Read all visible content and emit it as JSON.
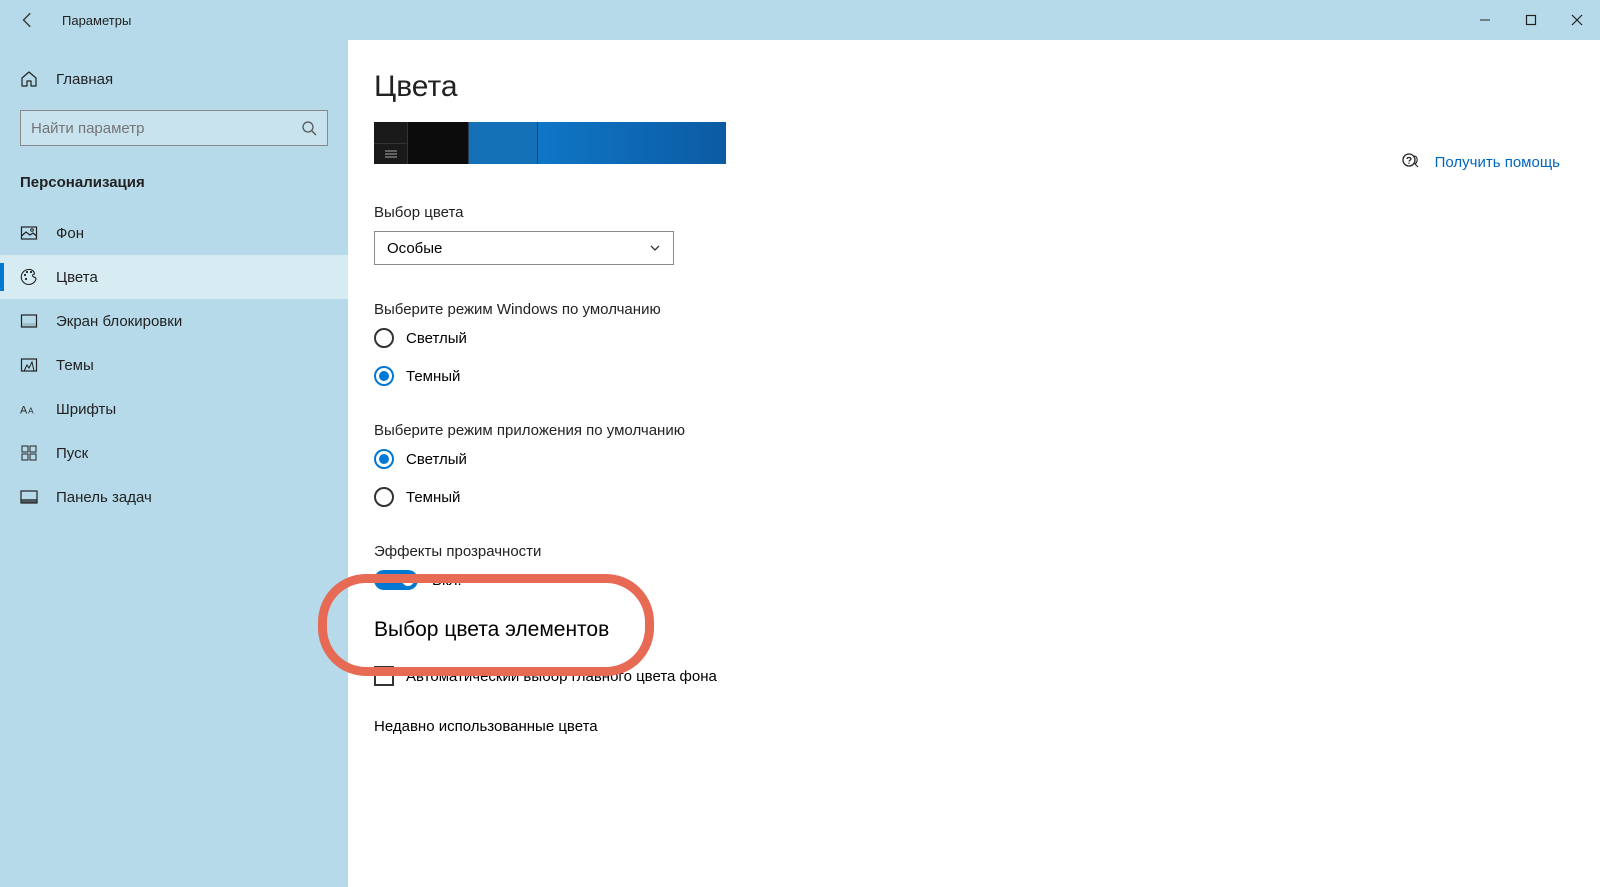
{
  "titlebar": {
    "app_name": "Параметры"
  },
  "sidebar": {
    "home_label": "Главная",
    "search_placeholder": "Найти параметр",
    "section_label": "Персонализация",
    "items": [
      {
        "label": "Фон",
        "icon": "picture-icon"
      },
      {
        "label": "Цвета",
        "icon": "palette-icon"
      },
      {
        "label": "Экран блокировки",
        "icon": "lockscreen-icon"
      },
      {
        "label": "Темы",
        "icon": "themes-icon"
      },
      {
        "label": "Шрифты",
        "icon": "fonts-icon"
      },
      {
        "label": "Пуск",
        "icon": "start-icon"
      },
      {
        "label": "Панель задач",
        "icon": "taskbar-icon"
      }
    ]
  },
  "main": {
    "title": "Цвета",
    "color_choice_label": "Выбор цвета",
    "color_choice_value": "Особые",
    "windows_mode_label": "Выберите режим Windows по умолчанию",
    "windows_mode_light": "Светлый",
    "windows_mode_dark": "Темный",
    "app_mode_label": "Выберите режим приложения по умолчанию",
    "app_mode_light": "Светлый",
    "app_mode_dark": "Темный",
    "transparency_label": "Эффекты прозрачности",
    "transparency_state": "Вкл.",
    "accent_heading": "Выбор цвета элементов",
    "auto_accent_label": "Автоматический выбор главного цвета фона",
    "recent_colors_label": "Недавно использованные цвета"
  },
  "right": {
    "help_label": "Получить помощь"
  }
}
